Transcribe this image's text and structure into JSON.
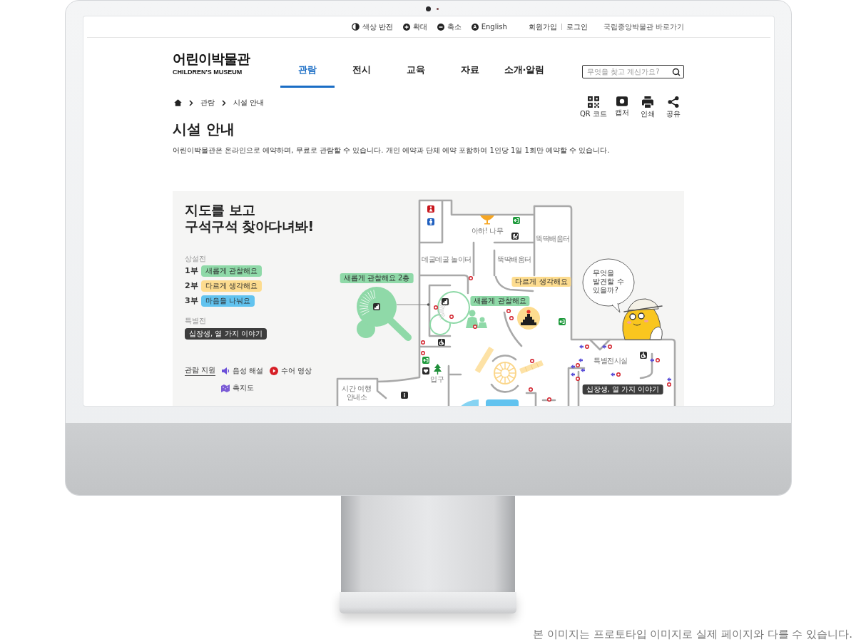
{
  "utility_bar": {
    "tools": [
      {
        "kind": "contrast",
        "label": "색상 반전"
      },
      {
        "kind": "zoom_in",
        "label": "확대"
      },
      {
        "kind": "zoom_out",
        "label": "축소"
      },
      {
        "kind": "language",
        "glyph": "A",
        "label": "English"
      }
    ],
    "account_links": [
      "회원가입",
      "로그인"
    ],
    "external_link": "국립중앙박물관 바로가기"
  },
  "header": {
    "logo": {
      "title": "어린이박물관",
      "subtitle": "CHILDREN'S MUSEUM"
    },
    "nav": [
      {
        "label": "관람",
        "selected": true
      },
      {
        "label": "전시",
        "selected": false
      },
      {
        "label": "교육",
        "selected": false
      },
      {
        "label": "자료",
        "selected": false
      },
      {
        "label": "소개·알림",
        "selected": false
      }
    ],
    "search": {
      "placeholder": "무엇을 찾고 계신가요?"
    }
  },
  "breadcrumb": [
    "관람",
    "시설 안내"
  ],
  "page_tools": [
    {
      "kind": "qr",
      "label": "QR 코드"
    },
    {
      "kind": "capture",
      "label": "캡처"
    },
    {
      "kind": "print",
      "label": "인쇄"
    },
    {
      "kind": "share",
      "label": "공유"
    }
  ],
  "title": "시설 안내",
  "description": "어린이박물관은 온라인으로 예약하며, 무료로 관람할 수 있습니다. 개인 예약과 단체 예약 포함하여 1인당 1일 1회만 예약할 수 있습니다.",
  "map": {
    "heading": [
      "지도를 보고",
      "구석구석 찾아다녀봐!"
    ],
    "permanent": {
      "label": "상설전",
      "parts": [
        {
          "number": "1부",
          "name": "새롭게 관찰해요",
          "color": "#8fd9a8"
        },
        {
          "number": "2부",
          "name": "다르게 생각해요",
          "color": "#fddc8f"
        },
        {
          "number": "3부",
          "name": "마음을 나눠요",
          "color": "#62c3ef"
        }
      ]
    },
    "special": {
      "label": "특별전",
      "name": "십장생, 열 가지 이야기"
    },
    "support": {
      "label": "관람 지원",
      "items": [
        {
          "kind": "audio",
          "label": "음성 해설"
        },
        {
          "kind": "sign",
          "label": "수어 영상"
        },
        {
          "kind": "tactile",
          "label": "촉지도"
        }
      ]
    },
    "places": [
      {
        "kind": "room",
        "lines": [
          "아하! 나무"
        ]
      },
      {
        "kind": "room",
        "lines": [
          "뚝딱배움터"
        ]
      },
      {
        "kind": "room",
        "lines": [
          "데굴데굴 놀이터"
        ]
      },
      {
        "kind": "room",
        "lines": [
          "뚝딱배움터"
        ]
      },
      {
        "kind": "tag",
        "lines": [
          "새롭게 관찰해요 2층"
        ],
        "color": "#8fd9a8"
      },
      {
        "kind": "tag",
        "lines": [
          "다르게 생각해요"
        ],
        "color": "#fddc8f"
      },
      {
        "kind": "tag",
        "lines": [
          "새롭게 관찰해요"
        ],
        "color": "#8fd9a8"
      },
      {
        "kind": "room",
        "lines": [
          "특별전시실"
        ]
      },
      {
        "kind": "room",
        "lines": [
          "입구"
        ]
      },
      {
        "kind": "room",
        "lines": [
          "시간 여행",
          "안내소"
        ]
      },
      {
        "kind": "tag",
        "lines": [
          "십장생, 열 가지 이야기"
        ],
        "color": "#3d3d3d"
      }
    ],
    "speech_bubble": [
      "무엇을",
      "발견할 수",
      "있을까?"
    ]
  },
  "caption": "본 이미지는 프로토타입 이미지로 실제 페이지와 다를 수 있습니다."
}
